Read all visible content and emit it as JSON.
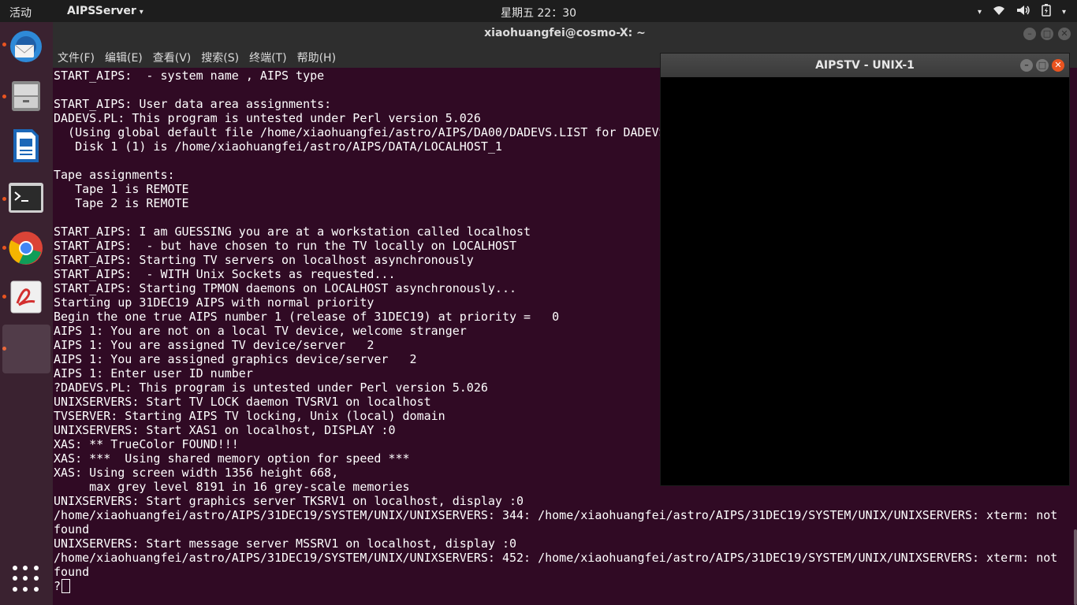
{
  "topbar": {
    "activities": "活动",
    "app_menu": "AIPSServer",
    "app_menu_arrow": "▾",
    "clock": "星期五 22：30",
    "tray_dropdown": "▾",
    "wifi_icon": "wifi-icon",
    "volume_icon": "volume-icon",
    "battery_icon": "battery-icon",
    "system_menu_arrow": "▾"
  },
  "dock": {
    "items": [
      {
        "name": "thunderbird",
        "icon": "mail-icon",
        "color": "#2e8ad8",
        "running": true
      },
      {
        "name": "files",
        "icon": "files-icon",
        "color": "#9b9b9b",
        "running": true
      },
      {
        "name": "libreoffice-writer",
        "icon": "document-icon",
        "color": "#1b67b8",
        "running": false
      },
      {
        "name": "terminal",
        "icon": "terminal-icon",
        "color": "#2b2b2b",
        "running": true
      },
      {
        "name": "chrome",
        "icon": "chrome-icon",
        "color": "#db4437",
        "running": true
      },
      {
        "name": "pdf-viewer",
        "icon": "pdf-icon",
        "color": "#d32f2f",
        "running": true
      }
    ],
    "show_apps": "show-apps-grid-icon"
  },
  "terminal": {
    "title": "xiaohuangfei@cosmo-X: ~",
    "menu": [
      "文件(F)",
      "编辑(E)",
      "查看(V)",
      "搜索(S)",
      "终端(T)",
      "帮助(H)"
    ],
    "background": "#300a24",
    "lines": [
      "START_AIPS:  - system name , AIPS type",
      "",
      "START_AIPS: User data area assignments:",
      "DADEVS.PL: This program is untested under Perl version 5.026",
      "  (Using global default file /home/xiaohuangfei/astro/AIPS/DA00/DADEVS.LIST for DADEVS",
      "   Disk 1 (1) is /home/xiaohuangfei/astro/AIPS/DATA/LOCALHOST_1",
      "",
      "Tape assignments:",
      "   Tape 1 is REMOTE",
      "   Tape 2 is REMOTE",
      "",
      "START_AIPS: I am GUESSING you are at a workstation called localhost",
      "START_AIPS:  - but have chosen to run the TV locally on LOCALHOST",
      "START_AIPS: Starting TV servers on localhost asynchronously",
      "START_AIPS:  - WITH Unix Sockets as requested...",
      "START_AIPS: Starting TPMON daemons on LOCALHOST asynchronously...",
      "Starting up 31DEC19 AIPS with normal priority",
      "Begin the one true AIPS number 1 (release of 31DEC19) at priority =   0",
      "AIPS 1: You are not on a local TV device, welcome stranger",
      "AIPS 1: You are assigned TV device/server   2",
      "AIPS 1: You are assigned graphics device/server   2",
      "AIPS 1: Enter user ID number",
      "?DADEVS.PL: This program is untested under Perl version 5.026",
      "UNIXSERVERS: Start TV LOCK daemon TVSRV1 on localhost",
      "TVSERVER: Starting AIPS TV locking, Unix (local) domain",
      "UNIXSERVERS: Start XAS1 on localhost, DISPLAY :0",
      "XAS: ** TrueColor FOUND!!!",
      "XAS: ***  Using shared memory option for speed ***",
      "XAS: Using screen width 1356 height 668,",
      "     max grey level 8191 in 16 grey-scale memories",
      "UNIXSERVERS: Start graphics server TKSRV1 on localhost, display :0",
      "/home/xiaohuangfei/astro/AIPS/31DEC19/SYSTEM/UNIX/UNIXSERVERS: 344: /home/xiaohuangfei/astro/AIPS/31DEC19/SYSTEM/UNIX/UNIXSERVERS: xterm: not",
      "found",
      "UNIXSERVERS: Start message server MSSRV1 on localhost, display :0",
      "/home/xiaohuangfei/astro/AIPS/31DEC19/SYSTEM/UNIX/UNIXSERVERS: 452: /home/xiaohuangfei/astro/AIPS/31DEC19/SYSTEM/UNIX/UNIXSERVERS: xterm: not",
      "found"
    ],
    "prompt": "?"
  },
  "aipstv": {
    "title": "AIPSTV - UNIX-1"
  }
}
